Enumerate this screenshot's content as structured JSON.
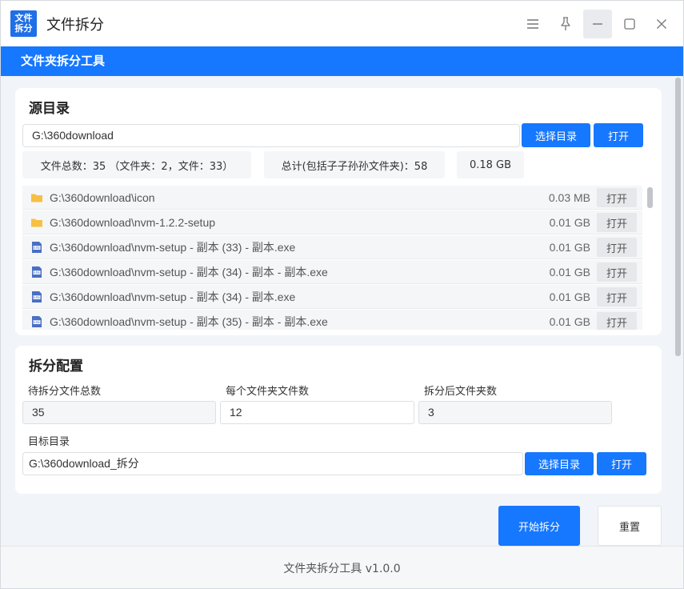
{
  "app": {
    "logo_line1": "文件",
    "logo_line2": "拆分",
    "title": "文件拆分"
  },
  "header": {
    "title": "文件夹拆分工具"
  },
  "source": {
    "section_title": "源目录",
    "path_value": "G:\\360download",
    "select_button": "选择目录",
    "open_button": "打开",
    "stats": {
      "total": "文件总数：35 （文件夹：2，文件：33）",
      "recursive_total": "总计(包括子子孙孙文件夹)：58",
      "size": "0.18 GB"
    },
    "files": [
      {
        "type": "folder",
        "path": "G:\\360download\\icon",
        "size": "0.03 MB",
        "open": "打开"
      },
      {
        "type": "folder",
        "path": "G:\\360download\\nvm-1.2.2-setup",
        "size": "0.01 GB",
        "open": "打开"
      },
      {
        "type": "exe",
        "path": "G:\\360download\\nvm-setup - 副本 (33) - 副本.exe",
        "size": "0.01 GB",
        "open": "打开"
      },
      {
        "type": "exe",
        "path": "G:\\360download\\nvm-setup - 副本 (34) - 副本 - 副本.exe",
        "size": "0.01 GB",
        "open": "打开"
      },
      {
        "type": "exe",
        "path": "G:\\360download\\nvm-setup - 副本 (34) - 副本.exe",
        "size": "0.01 GB",
        "open": "打开"
      },
      {
        "type": "exe",
        "path": "G:\\360download\\nvm-setup - 副本 (35) - 副本 - 副本.exe",
        "size": "0.01 GB",
        "open": "打开"
      }
    ]
  },
  "config": {
    "section_title": "拆分配置",
    "total_label": "待拆分文件总数",
    "total_value": "35",
    "per_folder_label": "每个文件夹文件数",
    "per_folder_value": "12",
    "result_label": "拆分后文件夹数",
    "result_value": "3",
    "target_label": "目标目录",
    "target_value": "G:\\360download_拆分",
    "select_button": "选择目录",
    "open_button": "打开"
  },
  "actions": {
    "start": "开始拆分",
    "reset": "重置"
  },
  "footer": {
    "text": "文件夹拆分工具 v1.0.0"
  },
  "colors": {
    "primary": "#1677ff",
    "folder": "#f6c042",
    "exe": "#4a6fc4"
  }
}
